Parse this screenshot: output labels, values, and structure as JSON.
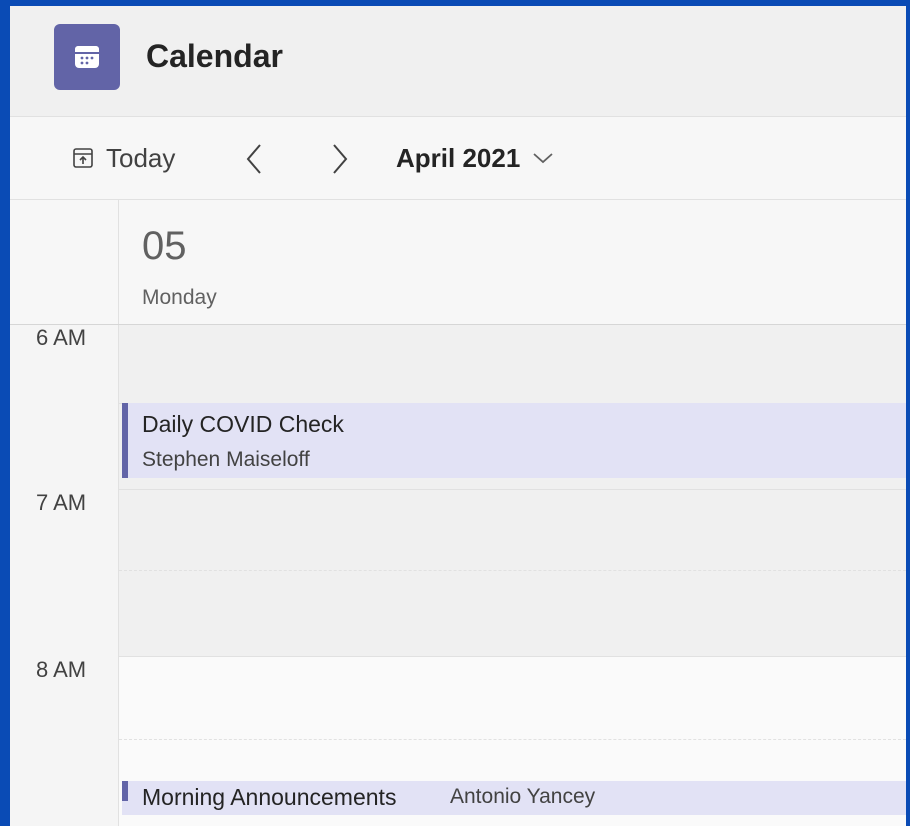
{
  "app": {
    "title": "Calendar",
    "icon": "calendar-icon",
    "accent": "#6264a7"
  },
  "toolbar": {
    "today_label": "Today",
    "month_label": "April 2021"
  },
  "day": {
    "number": "05",
    "name": "Monday"
  },
  "times": [
    "6 AM",
    "7 AM",
    "8 AM"
  ],
  "events": [
    {
      "title": "Daily COVID Check",
      "organizer": "Stephen Maiseloff"
    },
    {
      "title": "Morning Announcements",
      "organizer": "Antonio Yancey"
    }
  ]
}
